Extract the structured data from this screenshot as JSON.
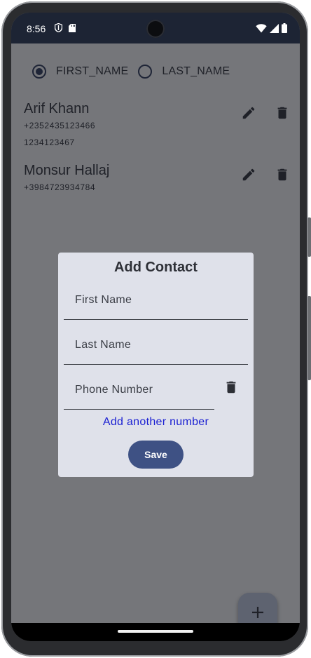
{
  "status_bar": {
    "time": "8:56",
    "icons_left": [
      "shield-icon",
      "sd-card-icon"
    ],
    "icons_right": [
      "wifi-icon",
      "signal-icon",
      "battery-icon"
    ]
  },
  "sort": {
    "options": [
      {
        "label": "FIRST_NAME",
        "selected": true
      },
      {
        "label": "LAST_NAME",
        "selected": false
      }
    ]
  },
  "contacts": [
    {
      "name": "Arif Khann",
      "phones": [
        "+2352435123466",
        "1234123467"
      ]
    },
    {
      "name": "Monsur Hallaj",
      "phones": [
        "+3984723934784"
      ]
    }
  ],
  "dialog": {
    "title": "Add Contact",
    "first_name_placeholder": "First Name",
    "last_name_placeholder": "Last Name",
    "phone_placeholder": "Phone Number",
    "add_number_label": "Add another number",
    "save_label": "Save"
  },
  "fab": {
    "icon": "plus-icon"
  },
  "colors": {
    "status_bar": "#1d2434",
    "scrim_background": "#75767a",
    "dialog_background": "#dfe1ea",
    "primary": "#3e5184",
    "link": "#1a1fd2"
  }
}
